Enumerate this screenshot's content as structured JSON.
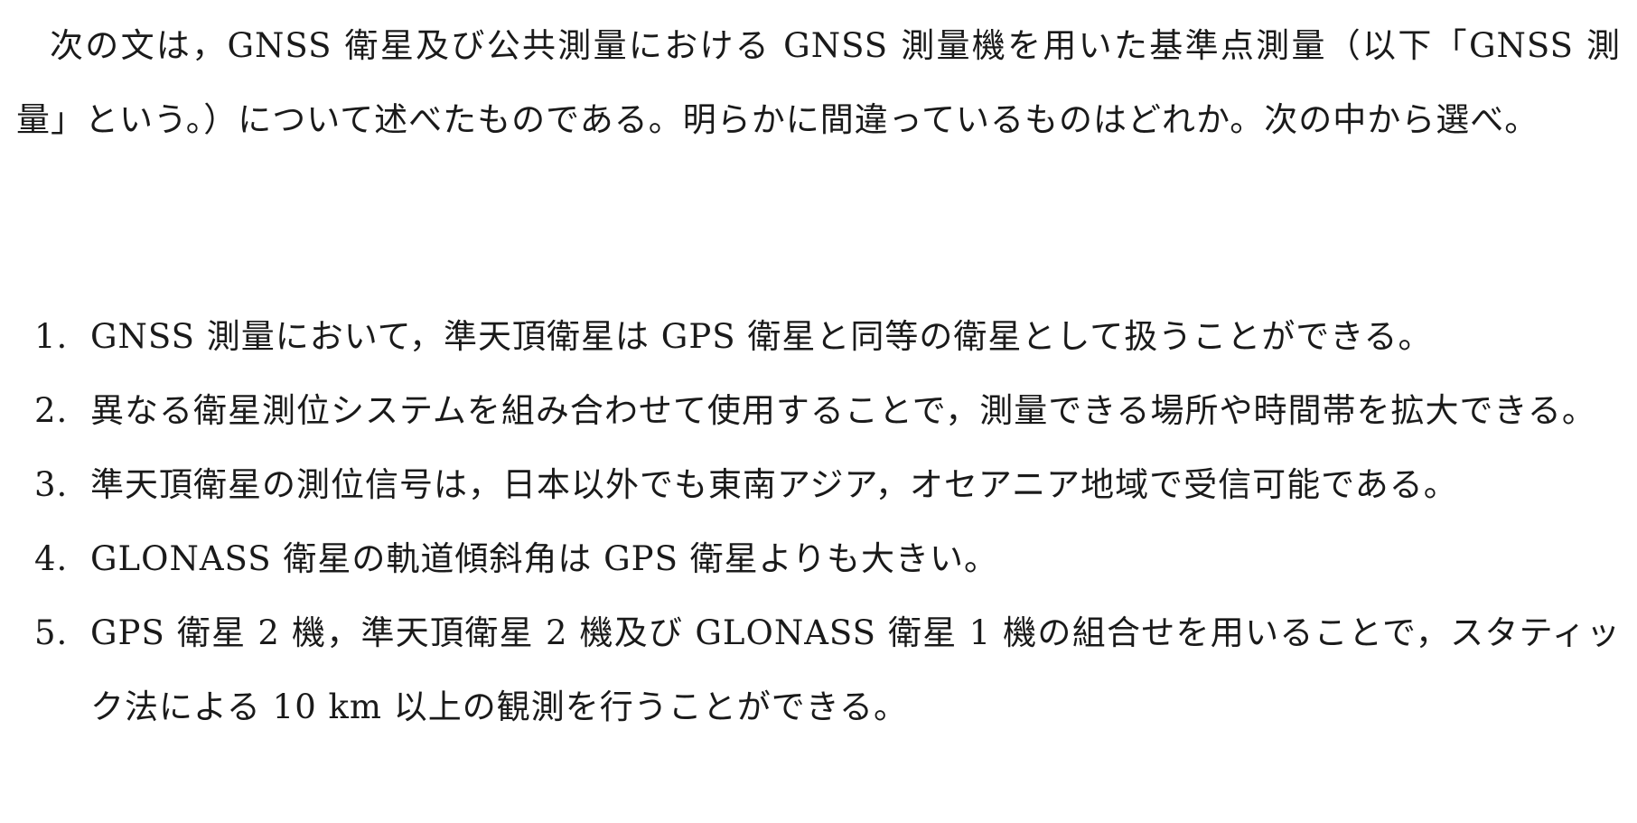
{
  "question": {
    "intro": "次の文は，GNSS 衛星及び公共測量における GNSS 測量機を用いた基準点測量（以下「GNSS 測量」という。）について述べたものである。明らかに間違っているものはどれか。次の中から選べ。"
  },
  "choices": [
    {
      "number": "1.",
      "text": "GNSS 測量において，準天頂衛星は GPS 衛星と同等の衛星として扱うことができる。"
    },
    {
      "number": "2.",
      "text": "異なる衛星測位システムを組み合わせて使用することで，測量できる場所や時間帯を拡大できる。"
    },
    {
      "number": "3.",
      "text": "準天頂衛星の測位信号は，日本以外でも東南アジア，オセアニア地域で受信可能である。"
    },
    {
      "number": "4.",
      "text": "GLONASS 衛星の軌道傾斜角は GPS 衛星よりも大きい。"
    },
    {
      "number": "5.",
      "text": "GPS 衛星 2 機，準天頂衛星 2 機及び GLONASS 衛星 1 機の組合せを用いることで，スタティック法による 10 km 以上の観測を行うことができる。"
    }
  ]
}
